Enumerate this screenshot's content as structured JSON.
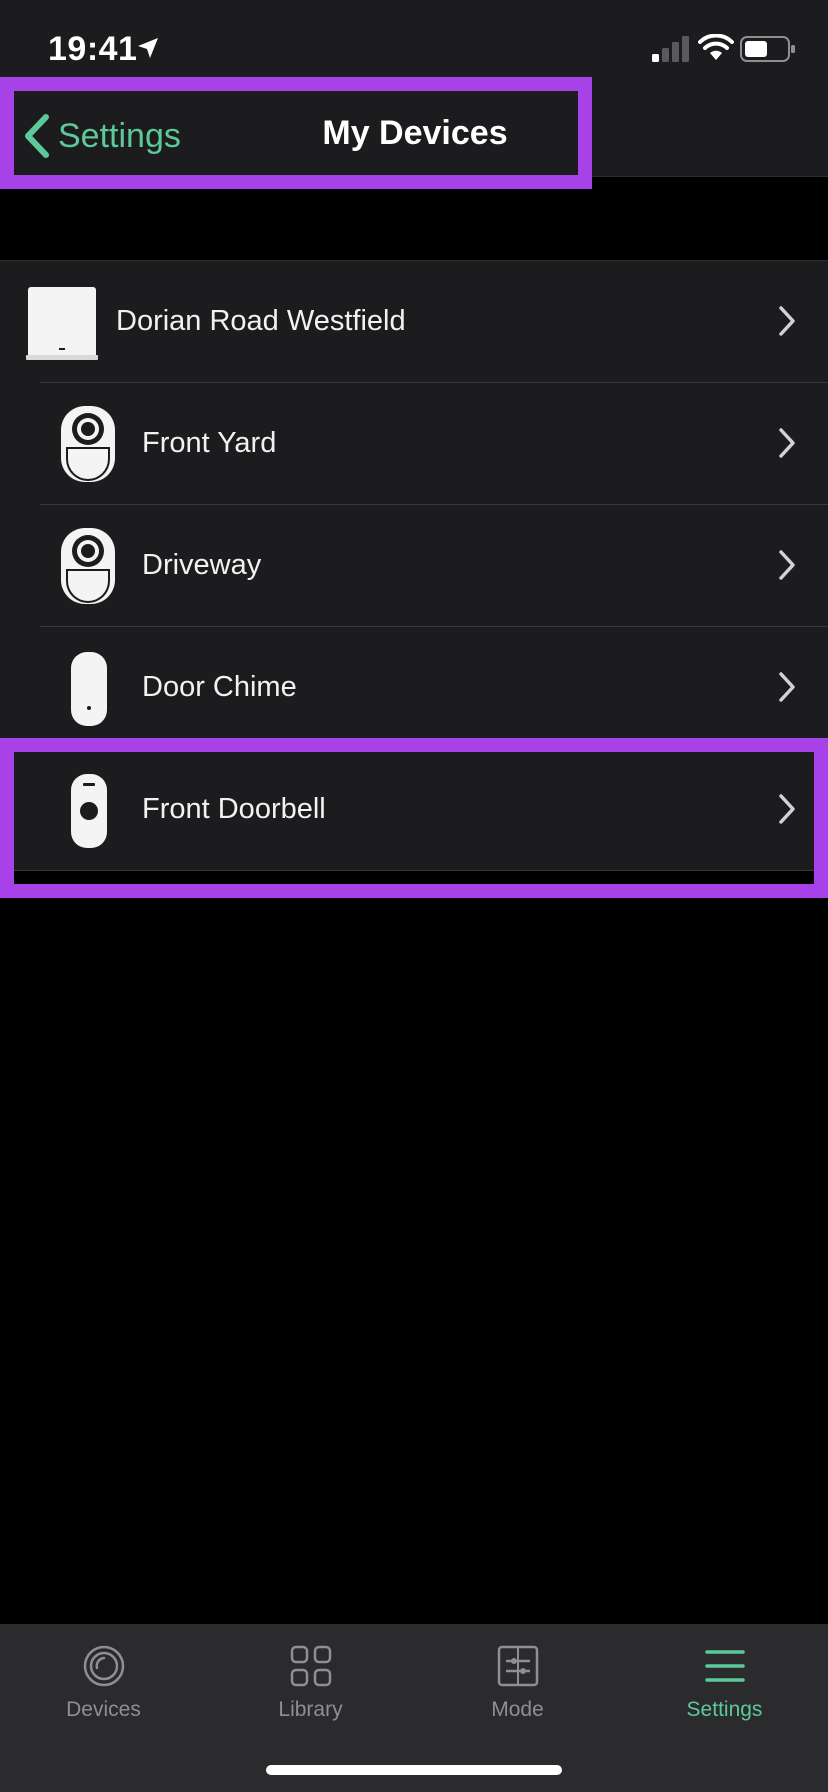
{
  "status_bar": {
    "time": "19:41"
  },
  "nav": {
    "back_label": "Settings",
    "title": "My Devices"
  },
  "devices": [
    {
      "label": "Dorian Road Westfield",
      "icon": "base-station-icon"
    },
    {
      "label": "Front Yard",
      "icon": "camera-icon"
    },
    {
      "label": "Driveway",
      "icon": "camera-icon"
    },
    {
      "label": "Door Chime",
      "icon": "chime-icon"
    },
    {
      "label": "Front Doorbell",
      "icon": "doorbell-icon"
    }
  ],
  "tabs": [
    {
      "label": "Devices",
      "icon": "camera-lens-icon",
      "active": false
    },
    {
      "label": "Library",
      "icon": "grid-icon",
      "active": false
    },
    {
      "label": "Mode",
      "icon": "sliders-icon",
      "active": false
    },
    {
      "label": "Settings",
      "icon": "menu-icon",
      "active": true
    }
  ],
  "colors": {
    "accent": "#5cc99a",
    "highlight": "#a742e8",
    "surface": "#1c1c1e",
    "background": "#000000",
    "tab_bar": "#2b2b2d",
    "inactive": "#8e8e93"
  }
}
